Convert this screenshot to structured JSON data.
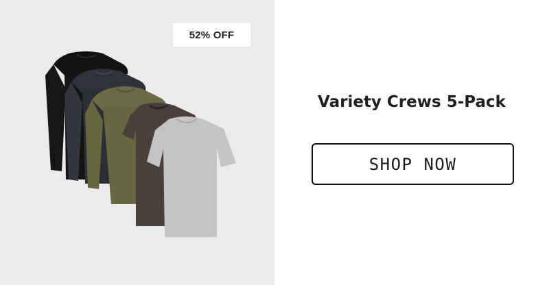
{
  "product": {
    "discount_badge": "52% OFF",
    "image_icon": "tshirt-5-pack-icon",
    "shirt_colors": [
      "#121212",
      "#2f3238",
      "#6b6b47",
      "#4a403b",
      "#c4c4c4"
    ]
  },
  "info": {
    "title": "Variety Crews 5-Pack",
    "cta_label": "SHOP NOW"
  }
}
